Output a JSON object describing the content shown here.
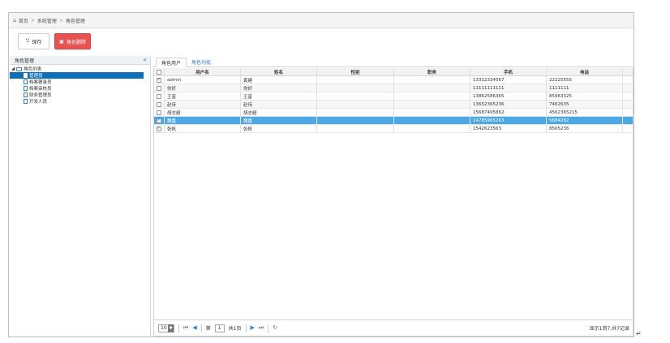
{
  "breadcrumb": {
    "items": [
      "首页",
      "系统管理",
      "角色管理"
    ]
  },
  "toolbar": {
    "save_label": "保存",
    "delete_label": "角色删除"
  },
  "left_panel": {
    "title": "角色管理",
    "tree_root": "角色列表",
    "tree_items": [
      "管理员",
      "档案著录员",
      "档案审核员",
      "财务管理员",
      "开发人员"
    ],
    "selected_index": 0
  },
  "tabs": [
    {
      "label": "角色用户",
      "active": true
    },
    {
      "label": "角色功能",
      "active": false
    }
  ],
  "grid": {
    "columns": [
      "用户名",
      "姓名",
      "性别",
      "职务",
      "手机",
      "电话"
    ],
    "rows": [
      {
        "checked": true,
        "selected": false,
        "cells": [
          "admin",
          "黄建",
          "",
          "",
          "13312334567",
          "22225555"
        ]
      },
      {
        "checked": false,
        "selected": false,
        "cells": [
          "你好",
          "你好",
          "",
          "",
          "11111111111",
          "1111111"
        ]
      },
      {
        "checked": false,
        "selected": false,
        "cells": [
          "王富",
          "王富",
          "",
          "",
          "13862586365",
          "85963325"
        ]
      },
      {
        "checked": false,
        "selected": false,
        "cells": [
          "赵侍",
          "赵侍",
          "",
          "",
          "13652365236",
          "7462635"
        ]
      },
      {
        "checked": false,
        "selected": false,
        "cells": [
          "胡志超",
          "胡志超",
          "",
          "",
          "15687495862",
          "4562365215"
        ]
      },
      {
        "checked": true,
        "selected": true,
        "cells": [
          "魏嘉",
          "魏嘉",
          "",
          "",
          "14785965263",
          "5684262"
        ]
      },
      {
        "checked": true,
        "selected": false,
        "cells": [
          "张帆",
          "张帆",
          "",
          "",
          "1542623563",
          "8565236"
        ]
      }
    ]
  },
  "pager": {
    "page_size": "10",
    "page_prefix": "第",
    "page": "1",
    "page_total": "共1页",
    "info": "显示1到7,共7记录"
  },
  "colors": {
    "selected_row": "#4ba7e6",
    "tree_selected": "#0d6fb8",
    "delete_button": "#e55353",
    "link": "#3a7fc6"
  }
}
